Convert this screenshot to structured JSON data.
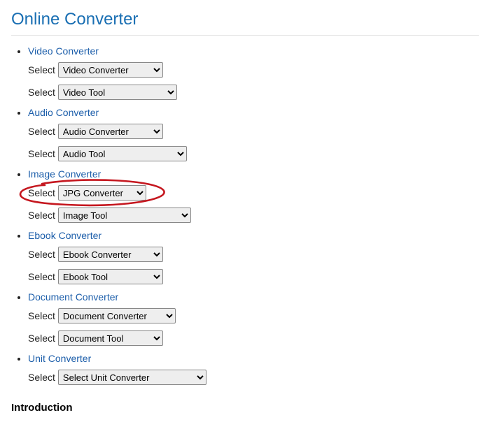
{
  "title": "Online Converter",
  "select_label": "Select",
  "intro_heading": "Introduction",
  "annotation": {
    "circled_index": 2,
    "color": "#c5171f"
  },
  "sections": [
    {
      "link_label": "Video Converter",
      "selects": [
        {
          "value": "Video Converter",
          "width_class": "w-video-conv",
          "name": "video-converter-select"
        },
        {
          "value": "Video Tool",
          "width_class": "w-video-tool",
          "name": "video-tool-select"
        }
      ]
    },
    {
      "link_label": "Audio Converter",
      "selects": [
        {
          "value": "Audio Converter",
          "width_class": "w-audio-conv",
          "name": "audio-converter-select"
        },
        {
          "value": "Audio Tool",
          "width_class": "w-audio-tool",
          "name": "audio-tool-select"
        }
      ]
    },
    {
      "link_label": "Image Converter",
      "selects": [
        {
          "value": "JPG Converter",
          "width_class": "w-image-conv",
          "name": "image-converter-select",
          "circled": true
        },
        {
          "value": "Image Tool",
          "width_class": "w-image-tool",
          "name": "image-tool-select"
        }
      ]
    },
    {
      "link_label": "Ebook Converter",
      "selects": [
        {
          "value": "Ebook Converter",
          "width_class": "w-ebook-conv",
          "name": "ebook-converter-select"
        },
        {
          "value": "Ebook Tool",
          "width_class": "w-ebook-tool",
          "name": "ebook-tool-select"
        }
      ]
    },
    {
      "link_label": "Document Converter",
      "selects": [
        {
          "value": "Document Converter",
          "width_class": "w-doc-conv",
          "name": "document-converter-select"
        },
        {
          "value": "Document Tool",
          "width_class": "w-doc-tool",
          "name": "document-tool-select"
        }
      ]
    },
    {
      "link_label": "Unit Converter",
      "selects": [
        {
          "value": "Select Unit Converter",
          "width_class": "w-unit-conv",
          "name": "unit-converter-select"
        }
      ]
    }
  ]
}
